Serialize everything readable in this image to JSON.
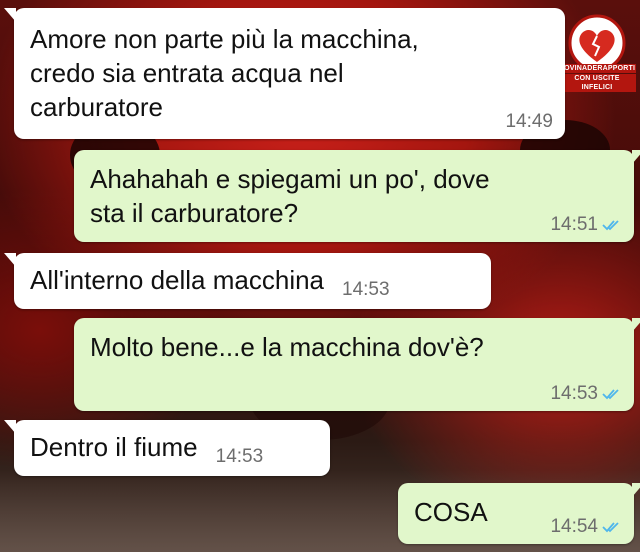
{
  "watermark": {
    "line1": "ROVINADERAPPORTI",
    "line2": "CON USCITE INFELICI",
    "icon": "broken-heart-logo-icon"
  },
  "messages": [
    {
      "direction": "incoming",
      "text": "Amore non parte più la macchina,\ncredo sia entrata acqua nel\ncarburatore",
      "time": "14:49"
    },
    {
      "direction": "outgoing",
      "text": "Ahahahah e spiegami un po', dove\nsta il carburatore?",
      "time": "14:51",
      "status": "read-double-check-icon"
    },
    {
      "direction": "incoming",
      "text": "All'interno della macchina",
      "time": "14:53"
    },
    {
      "direction": "outgoing",
      "text": "Molto bene...e la macchina dov'è?",
      "time": "14:53",
      "status": "read-double-check-icon"
    },
    {
      "direction": "incoming",
      "text": "Dentro il fiume",
      "time": "14:53"
    },
    {
      "direction": "outgoing",
      "text": "COSA",
      "time": "14:54",
      "status": "read-double-check-icon"
    }
  ],
  "colors": {
    "incoming_bubble": "#ffffff",
    "outgoing_bubble": "#e1f7cb",
    "read_tick": "#4fb6ec",
    "timestamp": "#6d6d6d"
  }
}
